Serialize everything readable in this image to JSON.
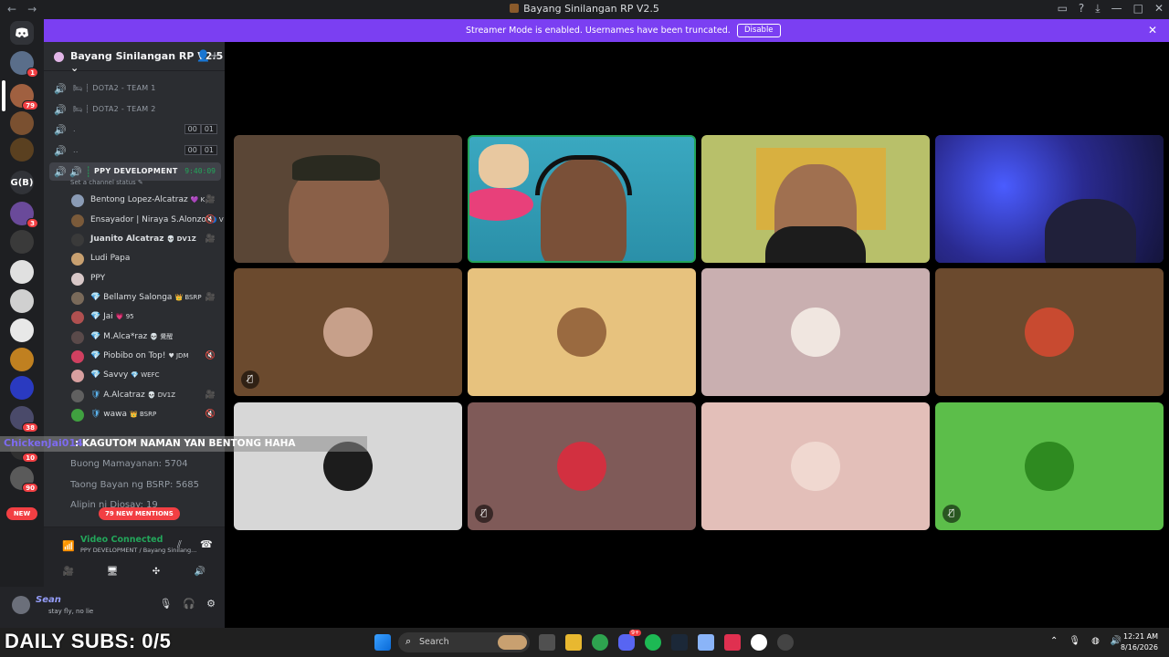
{
  "window": {
    "title": "Bayang Sinilangan RP V2.5",
    "nav_back": "←",
    "nav_forward": "→",
    "controls": [
      "▭",
      "?",
      "⤓",
      "—",
      "□",
      "✕"
    ]
  },
  "rail": {
    "badges": [
      "1",
      "79",
      "3",
      "38",
      "10",
      "90"
    ],
    "gb_label": "G(B)",
    "new_label": "NEW"
  },
  "guild": {
    "name": "Bayang Sinilangan RP V2.5",
    "chevron": "⌄"
  },
  "channels": [
    {
      "label": "DOTA2 - TEAM 1",
      "prefix": "🛏 ┊"
    },
    {
      "label": "DOTA2 - TEAM 2",
      "prefix": "🛏 ┊"
    },
    {
      "label": ".",
      "counts": [
        "00",
        "01"
      ]
    },
    {
      "label": "..",
      "counts": [
        "00",
        "01"
      ]
    }
  ],
  "active_channel": {
    "label": "PPY DEVELOPMENT",
    "timer": "9:40:09",
    "status": "Set a channel status"
  },
  "members": [
    {
      "name": "Bentong Lopez-Alcatraz",
      "tag": "💜 K",
      "icon": "🎥",
      "color": "#8a9bb5"
    },
    {
      "name": "Ensayador | Niraya S.Alonzo",
      "tag": "🔵 V",
      "icon": "🔇",
      "color": "#7a5a3a"
    },
    {
      "name": "Juanito Alcatraz",
      "tag": "💀 DV1Z",
      "icon": "🎥",
      "color": "#3a3a3a"
    },
    {
      "name": "Ludi Papa",
      "tag": "",
      "icon": "",
      "color": "#c8a070"
    },
    {
      "name": "PPY",
      "tag": "",
      "icon": "",
      "color": "#d8c8c8"
    },
    {
      "name": "Bellamy Salonga",
      "tag": "👑 BSRP",
      "icon": "🎥",
      "color": "#7a6a5a"
    },
    {
      "name": "Jai",
      "tag": "💗 95",
      "icon": "",
      "color": "#b05050"
    },
    {
      "name": "M.Alca*raz",
      "tag": "💀 覺醒",
      "icon": "",
      "color": "#5a4a4a"
    },
    {
      "name": "Piobibo on Top!",
      "tag": "♥ JDM",
      "icon": "🔇",
      "color": "#d04060"
    },
    {
      "name": "Savvy",
      "tag": "💎 WEFC",
      "icon": "",
      "color": "#d8a0a0"
    },
    {
      "name": "A.Alcatraz",
      "tag": "💀 DV1Z",
      "icon": "🎥",
      "color": "#606060"
    },
    {
      "name": "wawa",
      "tag": "👑 BSRP",
      "icon": "🔇",
      "color": "#40a040"
    }
  ],
  "text_channels": [
    "Buong Mamayanan: 5704",
    "Taong Bayan ng BSRP: 5685",
    "Alipin ni Diosay: 19"
  ],
  "mentions": "79 NEW MENTIONS",
  "voice": {
    "status": "Video Connected",
    "location": "PPY DEVELOPMENT / Bayang Sinilang...",
    "buttons": [
      "🎥",
      "🖥",
      "✣",
      "🔊"
    ]
  },
  "user": {
    "name": "Sean",
    "status": "stay fly, no lie"
  },
  "banner": {
    "message": "Streamer Mode is enabled. Usernames have been truncated.",
    "button": "Disable",
    "close": "✕"
  },
  "tiles": [
    {
      "kind": "cam",
      "bg": "#5a4636",
      "speaking": false
    },
    {
      "kind": "cam",
      "bg": "#3aa8c0",
      "speaking": true
    },
    {
      "kind": "cam",
      "bg": "#b8c06a",
      "speaking": false
    },
    {
      "kind": "cam",
      "bg": "#2a2a80",
      "speaking": false
    },
    {
      "kind": "avatar",
      "bg": "#6b4a2e",
      "av": "#c7a08a",
      "muted": true
    },
    {
      "kind": "avatar",
      "bg": "#e7c27e",
      "av": "#9a6a40",
      "muted": false
    },
    {
      "kind": "avatar",
      "bg": "#c9afb0",
      "av": "#f0e6e0",
      "muted": false
    },
    {
      "kind": "avatar",
      "bg": "#6b4a2e",
      "av": "#c84a30",
      "muted": false
    },
    {
      "kind": "avatar",
      "bg": "#d7d7d7",
      "av": "#1c1c1c",
      "muted": false
    },
    {
      "kind": "avatar",
      "bg": "#7f5a58",
      "av": "#d23040",
      "muted": true
    },
    {
      "kind": "avatar",
      "bg": "#e3bfb9",
      "av": "#f0d8d0",
      "muted": false
    },
    {
      "kind": "avatar",
      "bg": "#5cbe4a",
      "av": "#2e8a20",
      "muted": true
    }
  ],
  "chat": {
    "user": "ChickenJai014",
    "message": ": KAGUTOM NAMAN YAN BENTONG HAHA"
  },
  "overlay": {
    "subs": "DAILY SUBS: 0/5"
  },
  "taskbar": {
    "search_label": "Search",
    "discord_badge": "9+",
    "time": "12:21 AM",
    "date": "8/16/2026"
  },
  "colors": {
    "banner": "#7b3ff2",
    "online": "#23a55a",
    "mention": "#f23f43"
  }
}
